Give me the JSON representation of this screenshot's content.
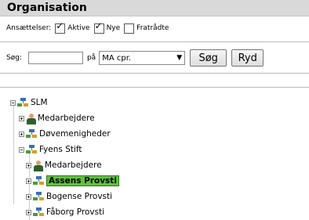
{
  "header": {
    "title": "Organisation"
  },
  "filters": {
    "label": "Ansættelser:",
    "options": [
      {
        "label": "Aktive",
        "checked": true
      },
      {
        "label": "Nye",
        "checked": true
      },
      {
        "label": "Fratrådte",
        "checked": false
      }
    ]
  },
  "search": {
    "label": "Søg:",
    "query_value": "",
    "on_label": "på",
    "field_selected": "MA cpr.",
    "search_button": "Søg",
    "clear_button": "Ryd"
  },
  "tree": [
    {
      "label": "SLM",
      "icon": "org-icon",
      "expanded": true,
      "selected": false
    },
    {
      "label": "Medarbejdere",
      "icon": "person-icon",
      "expanded": false,
      "selected": false
    },
    {
      "label": "Døvemenigheder",
      "icon": "org-icon",
      "expanded": false,
      "selected": false
    },
    {
      "label": "Fyens Stift",
      "icon": "org-icon",
      "expanded": true,
      "selected": false
    },
    {
      "label": "Medarbejdere",
      "icon": "person-icon",
      "expanded": false,
      "selected": false
    },
    {
      "label": "Assens Provsti",
      "icon": "org-icon",
      "expanded": false,
      "selected": true
    },
    {
      "label": "Bogense Provsti",
      "icon": "org-icon",
      "expanded": false,
      "selected": false
    },
    {
      "label": "Fåborg Provsti",
      "icon": "org-icon",
      "expanded": false,
      "selected": false
    }
  ]
}
